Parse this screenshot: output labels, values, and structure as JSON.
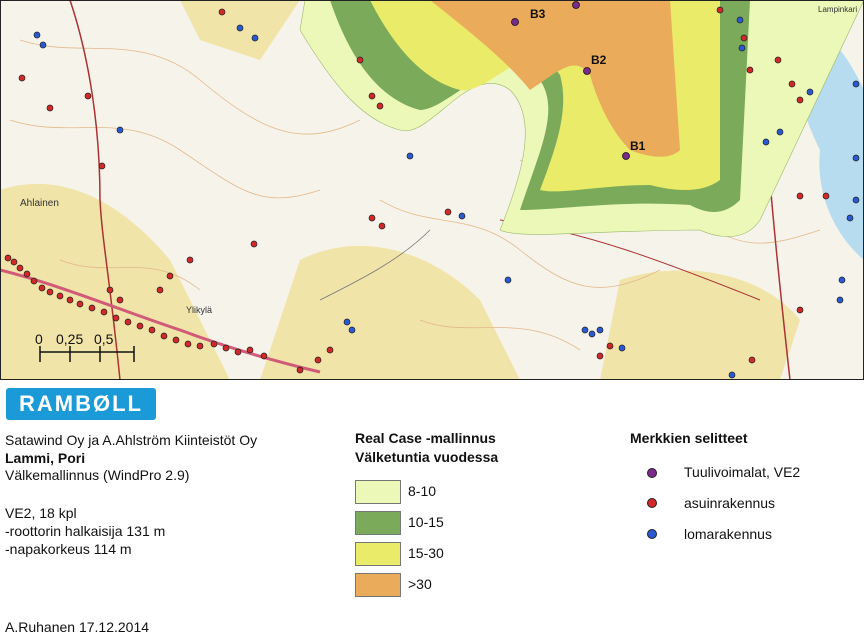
{
  "map": {
    "turbines": [
      {
        "label": "B3"
      },
      {
        "label": "B2"
      },
      {
        "label": "B1"
      }
    ],
    "place_labels": [
      "Ahlainen",
      "Ylikylä",
      "Lampinkari"
    ],
    "scale_labels": [
      "0",
      "0,25",
      "0,5"
    ]
  },
  "logo_text": "RAMBØLL",
  "info": {
    "client": "Satawind Oy ja A.Ahlström Kiinteistöt Oy",
    "project": "Lammi, Pori",
    "model": "Välkemallinnus (WindPro 2.9)",
    "layout": "VE2, 18 kpl",
    "rotor": "-roottorin halkaisija 131 m",
    "hub": "-napakorkeus 114 m",
    "author_date": "A.Ruhanen 17.12.2014"
  },
  "legend": {
    "title1": "Real Case -mallinnus",
    "title2": "Välketuntia vuodessa",
    "classes": [
      {
        "label": "8-10",
        "color": "#ecf8b8"
      },
      {
        "label": "10-15",
        "color": "#7aaa5a"
      },
      {
        "label": "15-30",
        "color": "#eaeb68"
      },
      {
        "label": ">30",
        "color": "#eaab5a"
      }
    ]
  },
  "symbols": {
    "title": "Merkkien selitteet",
    "items": [
      {
        "label": "Tuulivoimalat, VE2",
        "color": "#7a2a8a"
      },
      {
        "label": "asuinrakennus",
        "color": "#d22828"
      },
      {
        "label": "lomarakennus",
        "color": "#2a5ad2"
      }
    ]
  }
}
